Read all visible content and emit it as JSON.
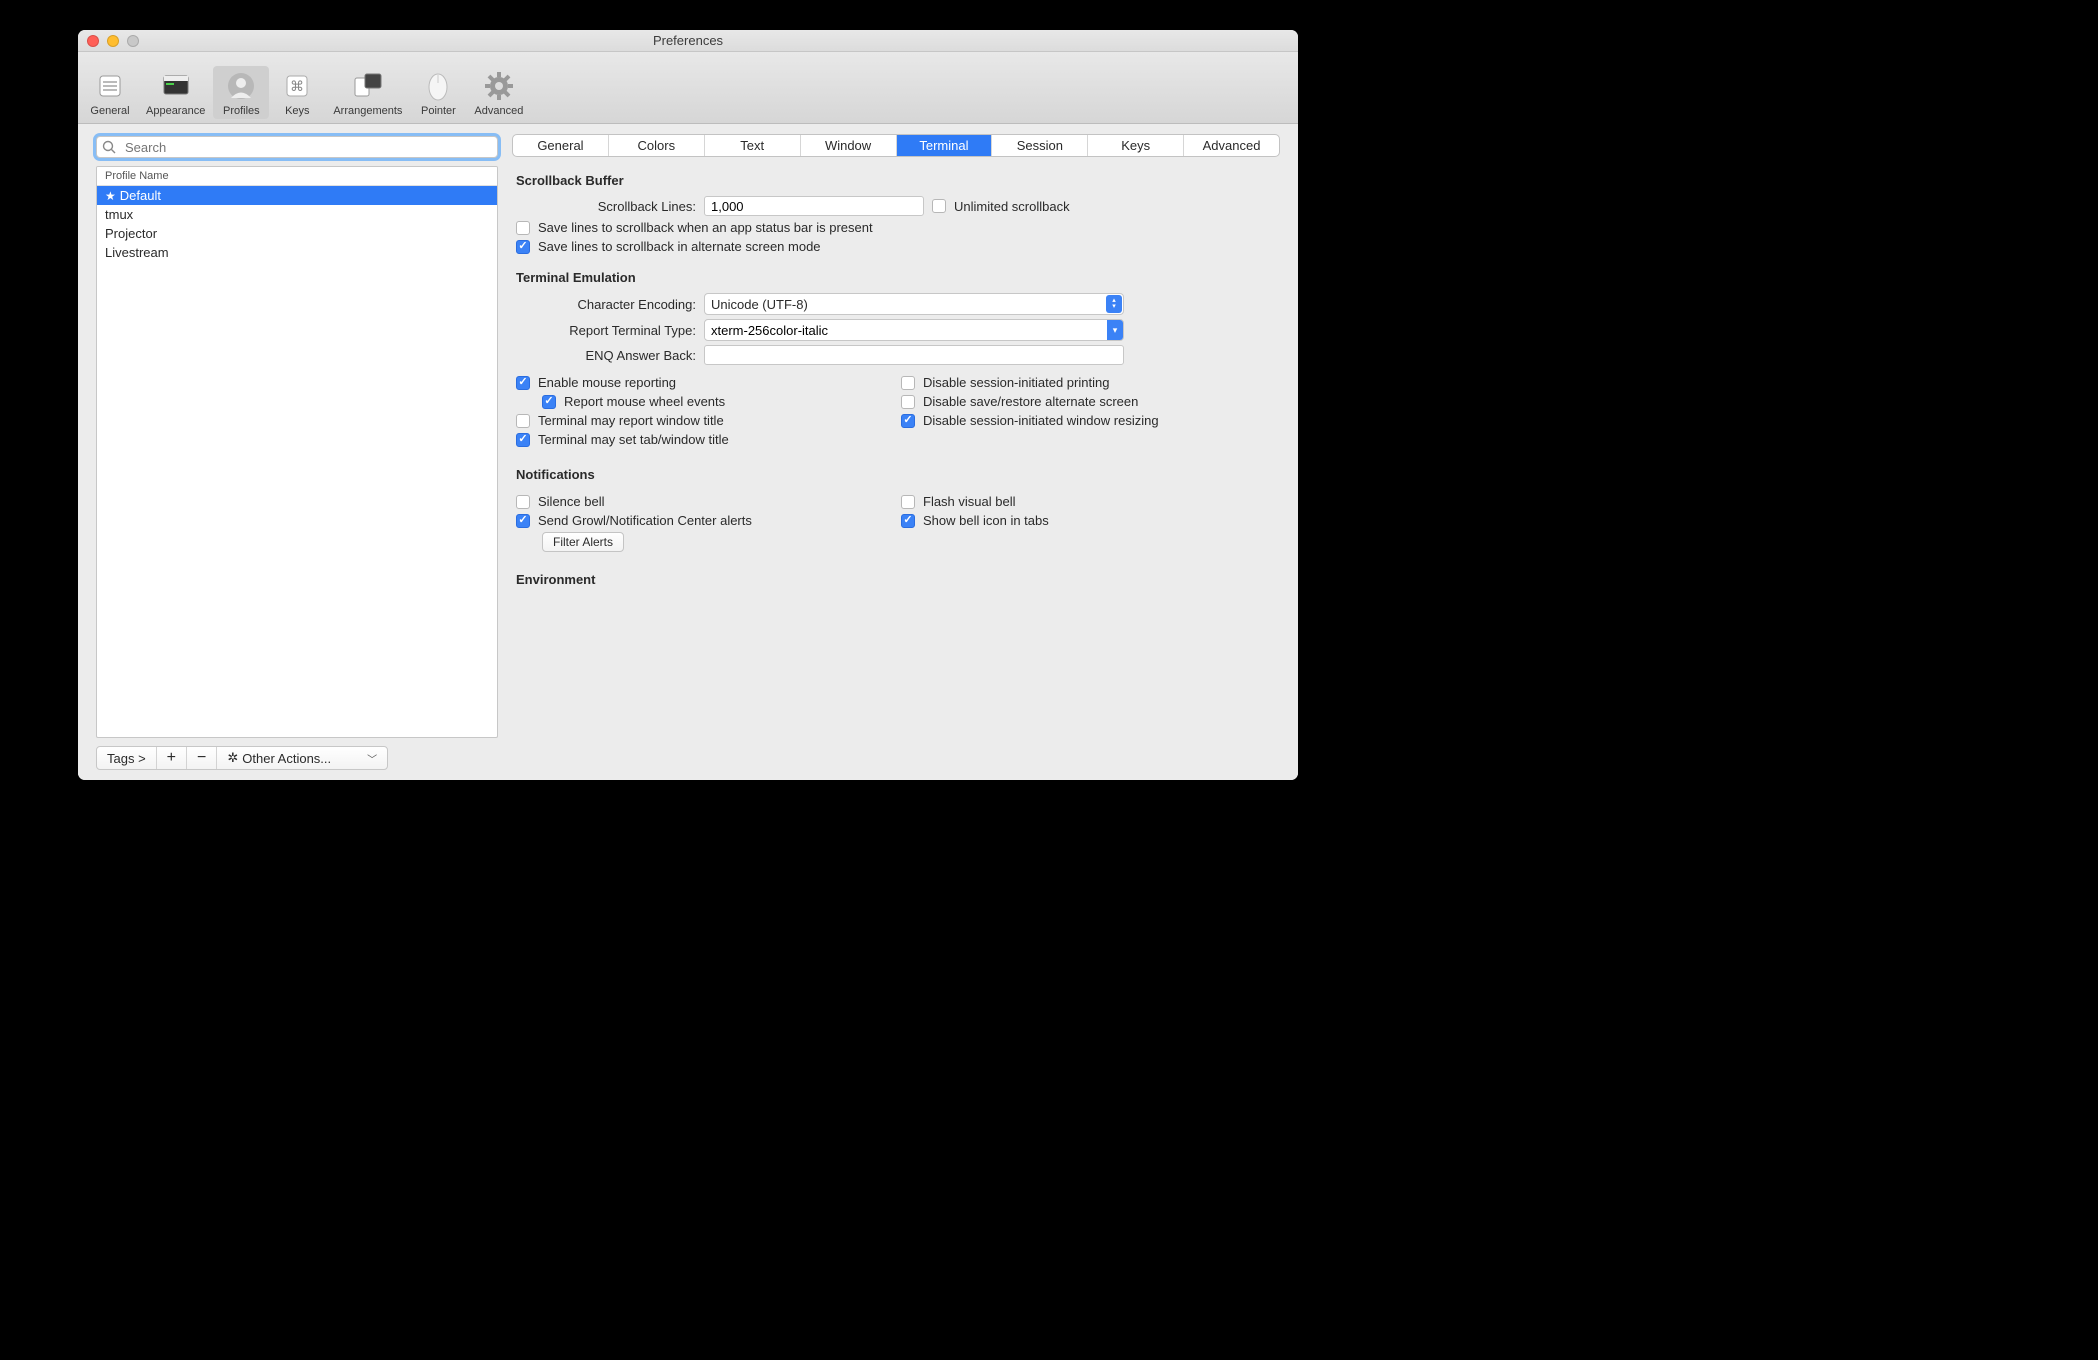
{
  "window": {
    "title": "Preferences"
  },
  "toolbar": {
    "items": [
      {
        "id": "general",
        "label": "General"
      },
      {
        "id": "appearance",
        "label": "Appearance"
      },
      {
        "id": "profiles",
        "label": "Profiles",
        "selected": true
      },
      {
        "id": "keys",
        "label": "Keys"
      },
      {
        "id": "arrangements",
        "label": "Arrangements"
      },
      {
        "id": "pointer",
        "label": "Pointer"
      },
      {
        "id": "advanced",
        "label": "Advanced"
      }
    ]
  },
  "sidebar": {
    "search_placeholder": "Search",
    "search_value": "",
    "list_header": "Profile Name",
    "items": [
      {
        "label": "Default",
        "star": true,
        "selected": true
      },
      {
        "label": "tmux"
      },
      {
        "label": "Projector"
      },
      {
        "label": "Livestream"
      }
    ],
    "footer": {
      "tags_label": "Tags >",
      "add_label": "+",
      "remove_label": "−",
      "other_actions_label": "Other Actions..."
    }
  },
  "tabs": [
    {
      "label": "General"
    },
    {
      "label": "Colors"
    },
    {
      "label": "Text"
    },
    {
      "label": "Window"
    },
    {
      "label": "Terminal",
      "selected": true
    },
    {
      "label": "Session"
    },
    {
      "label": "Keys"
    },
    {
      "label": "Advanced"
    }
  ],
  "sections": {
    "scrollback": {
      "title": "Scrollback Buffer",
      "lines_label": "Scrollback Lines:",
      "lines_value": "1,000",
      "unlimited": {
        "label": "Unlimited scrollback",
        "checked": false
      },
      "save_statusbar": {
        "label": "Save lines to scrollback when an app status bar is present",
        "checked": false
      },
      "save_altscreen": {
        "label": "Save lines to scrollback in alternate screen mode",
        "checked": true
      }
    },
    "emulation": {
      "title": "Terminal Emulation",
      "encoding_label": "Character Encoding:",
      "encoding_value": "Unicode (UTF-8)",
      "report_type_label": "Report Terminal Type:",
      "report_type_value": "xterm-256color-italic",
      "enq_label": "ENQ Answer Back:",
      "enq_value": "",
      "left": {
        "enable_mouse": {
          "label": "Enable mouse reporting",
          "checked": true
        },
        "report_wheel": {
          "label": "Report mouse wheel events",
          "checked": true
        },
        "report_title": {
          "label": "Terminal may report window title",
          "checked": false
        },
        "set_title": {
          "label": "Terminal may set tab/window title",
          "checked": true
        }
      },
      "right": {
        "disable_print": {
          "label": "Disable session-initiated printing",
          "checked": false
        },
        "disable_altrs": {
          "label": "Disable save/restore alternate screen",
          "checked": false
        },
        "disable_resize": {
          "label": "Disable session-initiated window resizing",
          "checked": true
        }
      }
    },
    "notifications": {
      "title": "Notifications",
      "left": {
        "silence_bell": {
          "label": "Silence bell",
          "checked": false
        },
        "send_growl": {
          "label": "Send Growl/Notification Center alerts",
          "checked": true
        }
      },
      "right": {
        "flash_bell": {
          "label": "Flash visual bell",
          "checked": false
        },
        "show_bell_icon": {
          "label": "Show bell icon in tabs",
          "checked": true
        }
      },
      "filter_alerts_label": "Filter Alerts"
    },
    "environment": {
      "title": "Environment"
    }
  }
}
